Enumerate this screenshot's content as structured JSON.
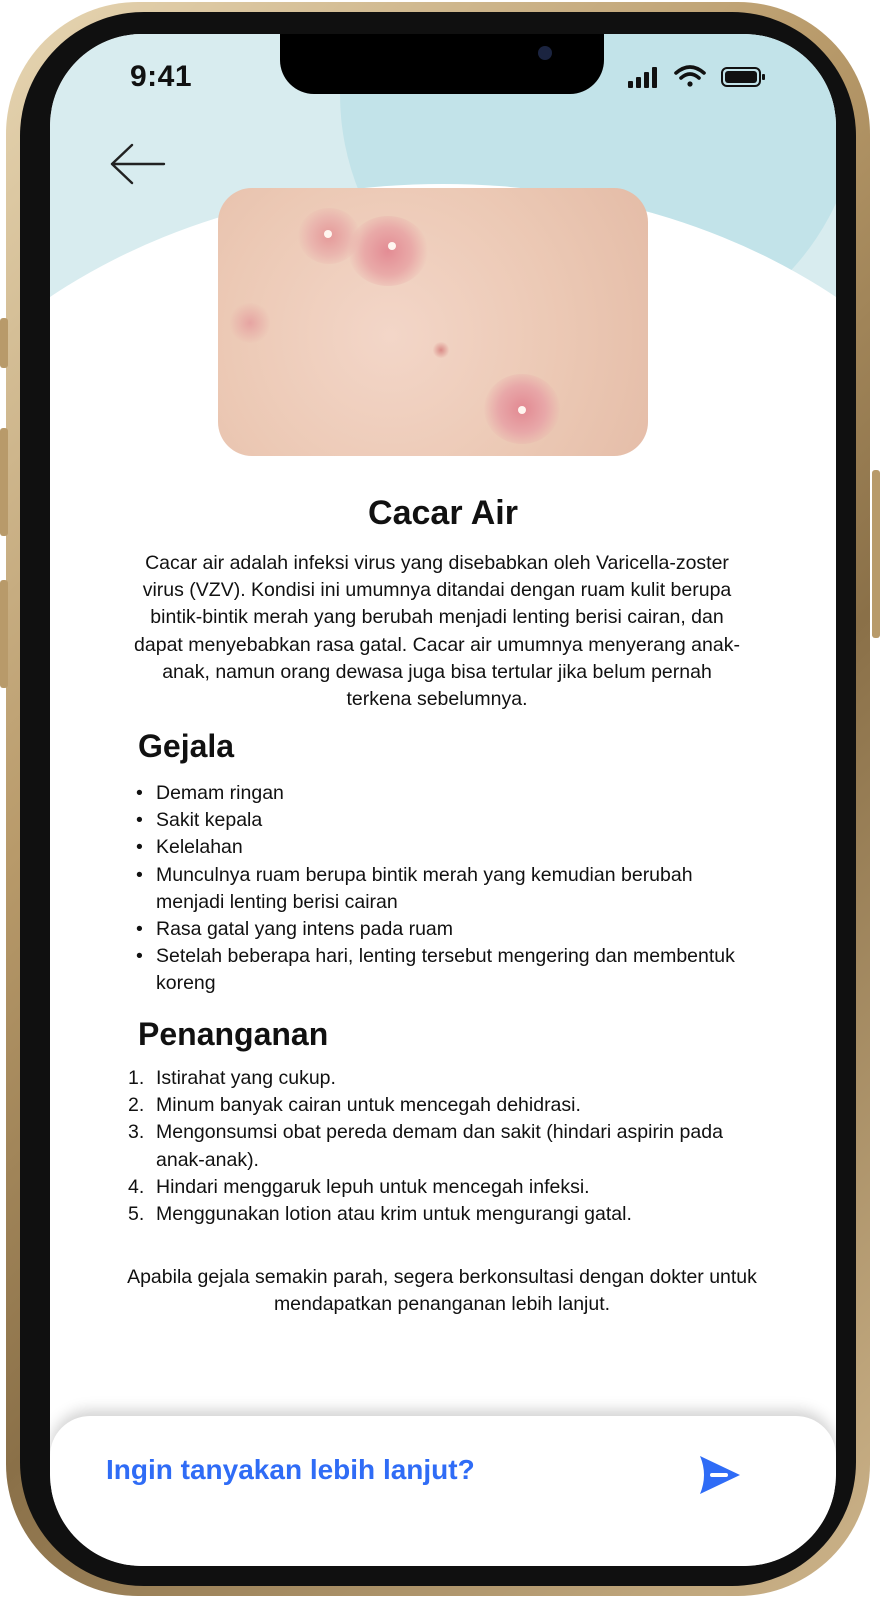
{
  "status_bar": {
    "time": "9:41"
  },
  "header": {
    "back_icon": "arrow-left-icon"
  },
  "hero": {
    "icon": "chickenpox-skin-photo"
  },
  "article": {
    "title": "Cacar Air",
    "description": "Cacar air adalah infeksi virus yang disebabkan oleh Varicella-zoster virus (VZV). Kondisi ini umumnya ditandai dengan ruam kulit berupa bintik-bintik merah yang berubah menjadi lenting berisi cairan, dan dapat menyebabkan rasa gatal. Cacar air umumnya menyerang anak-anak, namun orang dewasa juga bisa tertular jika belum pernah terkena sebelumnya.",
    "symptoms_heading": "Gejala",
    "symptoms": [
      "Demam ringan",
      "Sakit kepala",
      "Kelelahan",
      "Munculnya ruam berupa bintik merah yang kemudian berubah menjadi lenting berisi cairan",
      "Rasa gatal yang intens pada ruam",
      "Setelah beberapa hari, lenting tersebut mengering dan membentuk koreng"
    ],
    "treatment_heading": "Penanganan",
    "treatments": [
      "Istirahat yang cukup.",
      "Minum banyak cairan untuk mencegah dehidrasi.",
      "Mengonsumsi obat pereda demam dan sakit (hindari aspirin pada anak-anak).",
      "Hindari menggaruk lepuh untuk mencegah infeksi.",
      "Menggunakan lotion atau krim untuk mengurangi gatal."
    ],
    "footer": "Apabila gejala semakin parah, segera berkonsultasi dengan dokter untuk mendapatkan penanganan lebih lanjut."
  },
  "bottom_bar": {
    "prompt": "Ingin tanyakan lebih lanjut?",
    "send_icon": "send-icon"
  },
  "colors": {
    "accent": "#2f6cf6",
    "header_bg": "#d8ecef",
    "header_circle": "#c2e3e9",
    "text": "#111111"
  }
}
